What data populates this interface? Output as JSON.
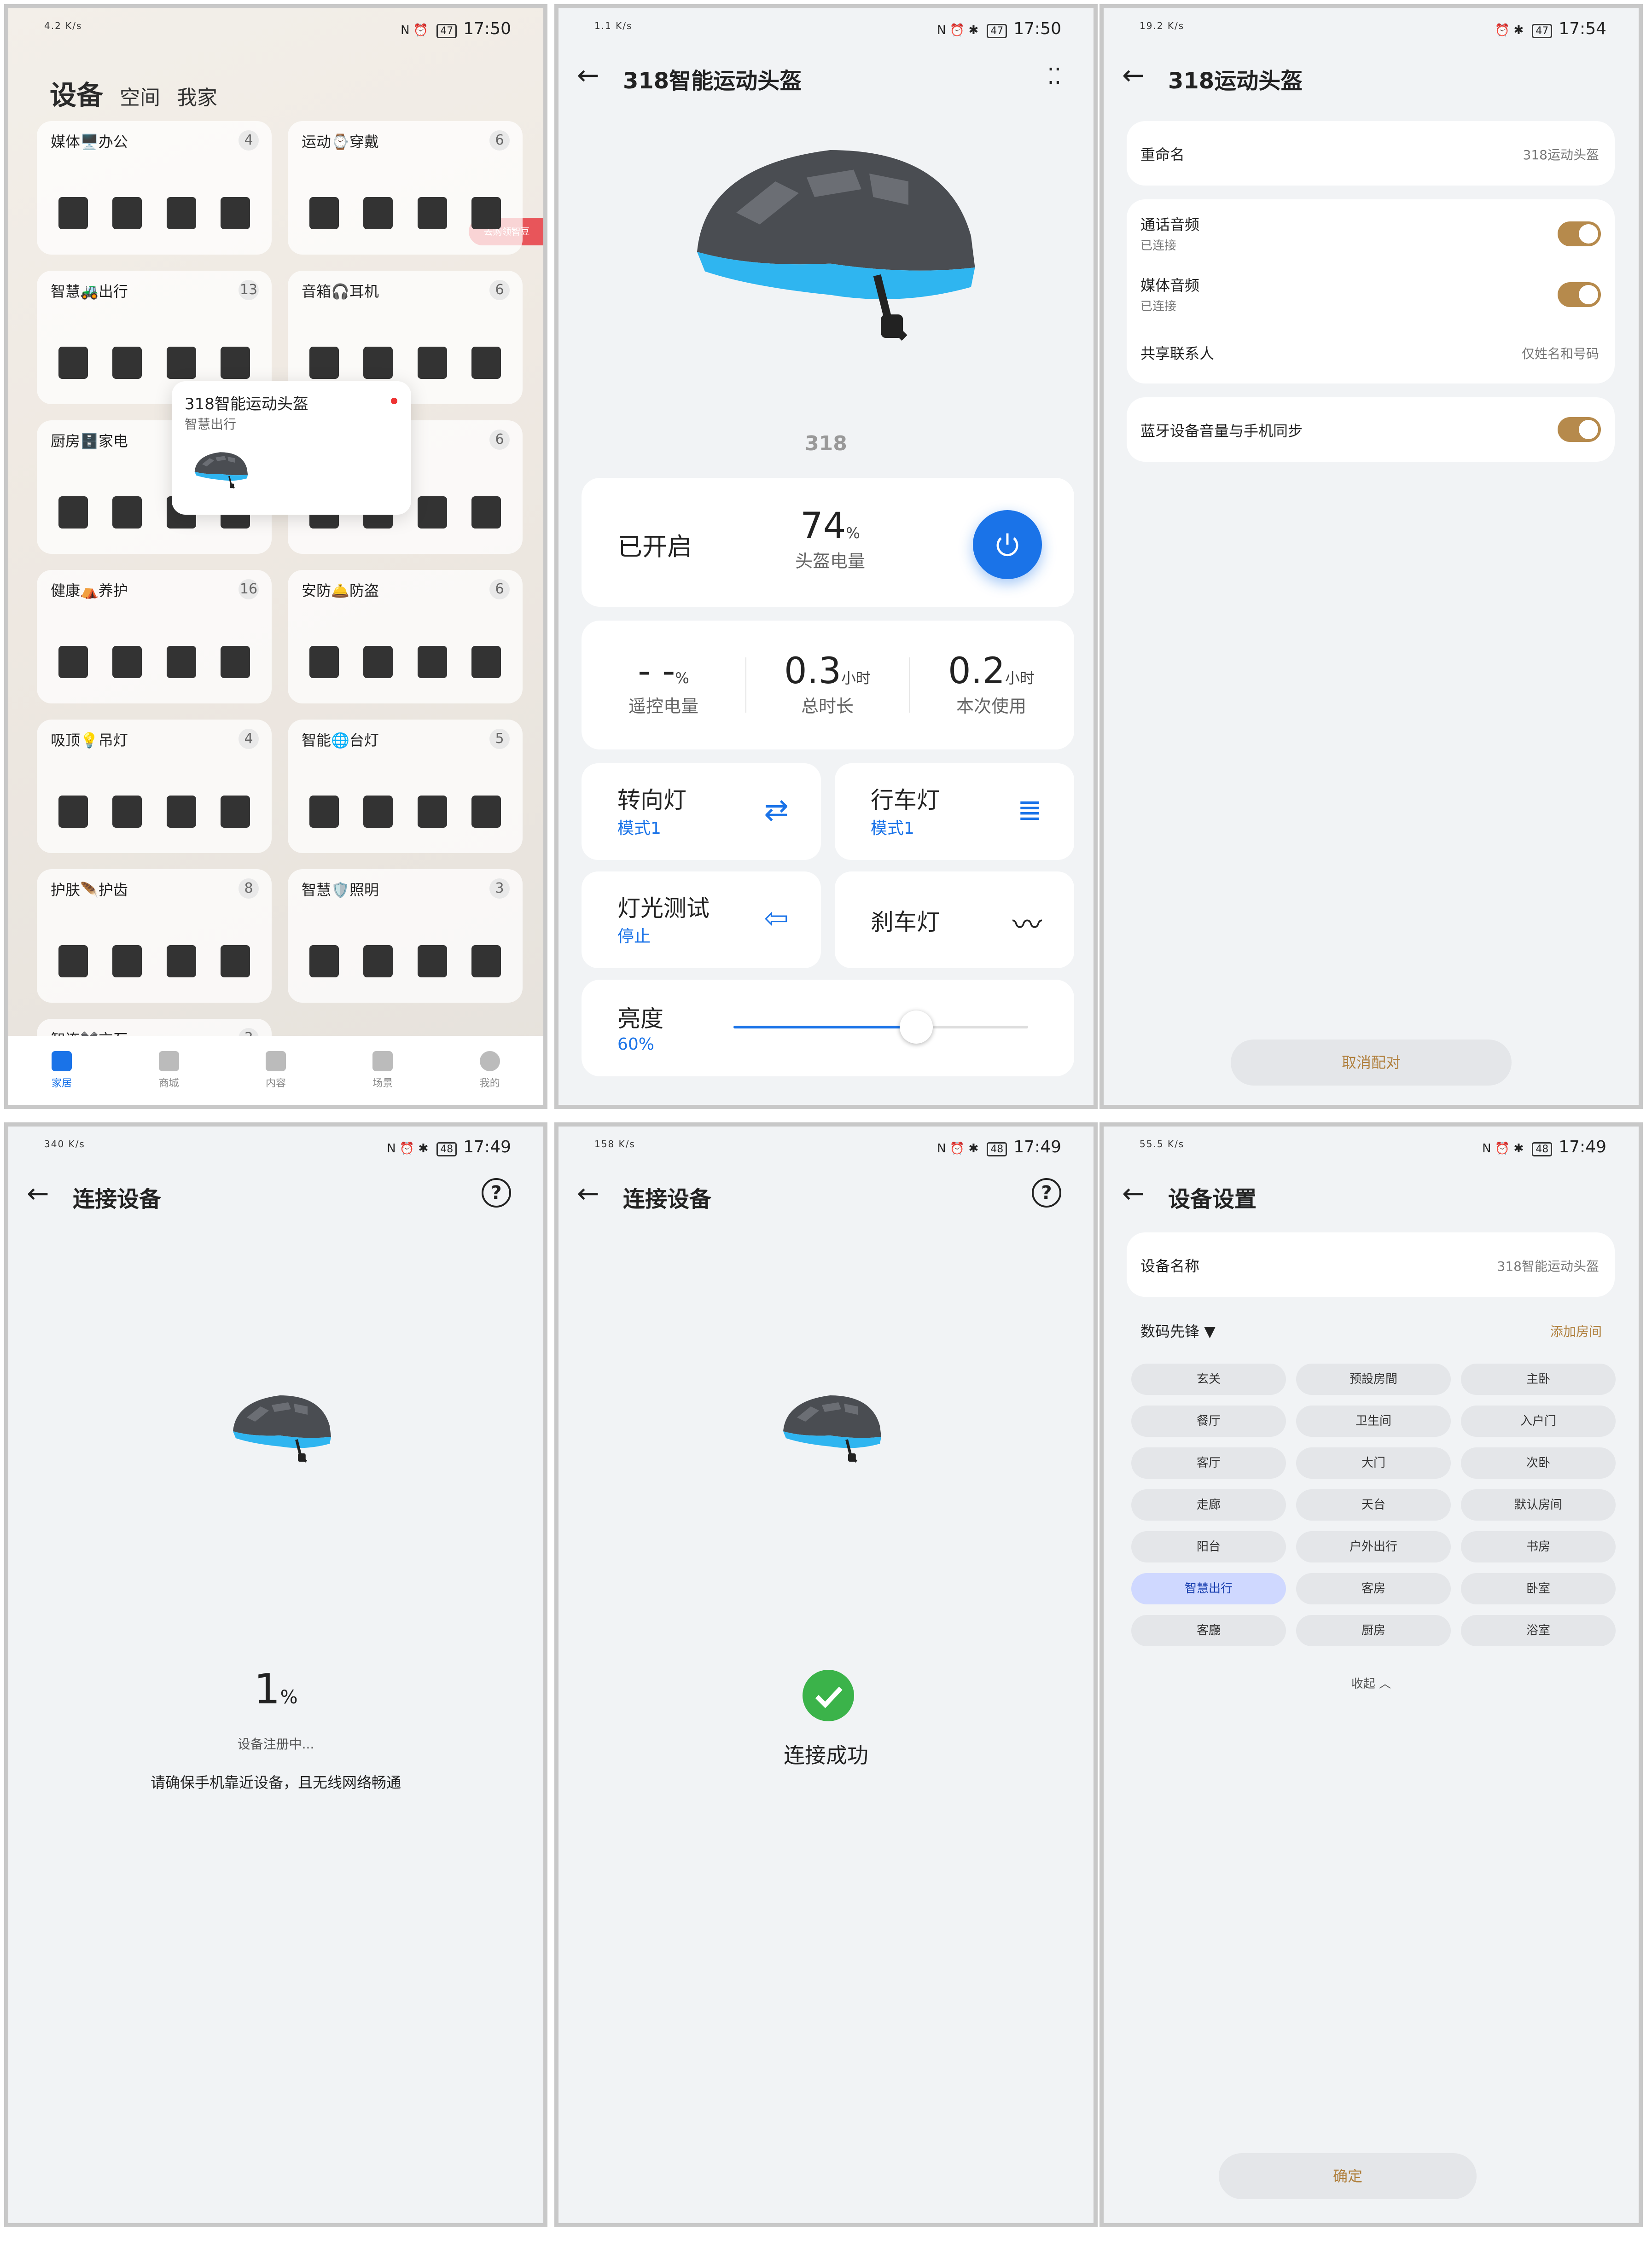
{
  "status": {
    "p1": {
      "speed": "4.2\nK/s",
      "time": "17:50",
      "battery": "47"
    },
    "p2": {
      "speed": "1.1\nK/s",
      "time": "17:50",
      "battery": "47"
    },
    "p3": {
      "speed": "19.2\nK/s",
      "time": "17:54",
      "battery": "47"
    },
    "p4": {
      "speed": "340\nK/s",
      "time": "17:49",
      "battery": "48"
    },
    "p5": {
      "speed": "158\nK/s",
      "time": "17:49",
      "battery": "48"
    },
    "p6": {
      "speed": "55.5\nK/s",
      "time": "17:49",
      "battery": "48"
    }
  },
  "home": {
    "tabs": [
      "设备",
      "空间",
      "我家"
    ],
    "groups": [
      {
        "name": "媒体🖥️办公",
        "count": "4"
      },
      {
        "name": "运动⌚穿戴",
        "count": "6"
      },
      {
        "name": "智慧🚜出行",
        "count": "13"
      },
      {
        "name": "音箱🎧耳机",
        "count": "6"
      },
      {
        "name": "厨房🗄️家电",
        "count": ""
      },
      {
        "name": "",
        "count": "6"
      },
      {
        "name": "健康⛺养护",
        "count": "16"
      },
      {
        "name": "安防🛎️防盗",
        "count": "6"
      },
      {
        "name": "吸顶💡吊灯",
        "count": "4"
      },
      {
        "name": "智能🌐台灯",
        "count": "5"
      },
      {
        "name": "护肤🪶护齿",
        "count": "8"
      },
      {
        "name": "智慧🛡️照明",
        "count": "3"
      },
      {
        "name": "智连✖️交互",
        "count": "3"
      }
    ],
    "badge": "去购领智豆",
    "popup": {
      "title": "318智能运动头盔",
      "subtitle": "智慧出行"
    },
    "nav": [
      "家居",
      "商城",
      "内容",
      "场景",
      "我的"
    ]
  },
  "helmet": {
    "title": "318智能运动头盔",
    "logo": "318",
    "state": "已开启",
    "battery_value": "74",
    "battery_unit": "%",
    "battery_label": "头盔电量",
    "stats": [
      {
        "value": "- -",
        "unit": "%",
        "label": "遥控电量"
      },
      {
        "value": "0.3",
        "unit": "小时",
        "label": "总时长"
      },
      {
        "value": "0.2",
        "unit": "小时",
        "label": "本次使用"
      }
    ],
    "tiles": [
      {
        "title": "转向灯",
        "sub": "模式1"
      },
      {
        "title": "行车灯",
        "sub": "模式1"
      },
      {
        "title": "灯光测试",
        "sub": "停止"
      },
      {
        "title": "刹车灯",
        "sub": ""
      }
    ],
    "brightness_label": "亮度",
    "brightness_value": "60%",
    "brightness_level": 0.6
  },
  "bt": {
    "title": "318运动头盔",
    "rename_label": "重命名",
    "rename_value": "318运动头盔",
    "call_label": "通话音频",
    "call_state": "已连接",
    "media_label": "媒体音频",
    "media_state": "已连接",
    "contacts_label": "共享联系人",
    "contacts_value": "仅姓名和号码",
    "sync_label": "蓝牙设备音量与手机同步",
    "unpair": "取消配对"
  },
  "connect": {
    "title": "连接设备",
    "progress": "1",
    "progress_unit": "%",
    "progress_text": "设备注册中...",
    "hint": "请确保手机靠近设备，且无线网络畅通",
    "success": "连接成功"
  },
  "settings": {
    "title": "设备设置",
    "name_label": "设备名称",
    "name_value": "318智能运动头盔",
    "group": "数码先锋",
    "add_room": "添加房间",
    "rooms": [
      "玄关",
      "预設房間",
      "主卧",
      "餐厅",
      "卫生间",
      "入户门",
      "客厅",
      "大门",
      "次卧",
      "走廊",
      "天台",
      "默认房间",
      "阳台",
      "户外出行",
      "书房",
      "智慧出行",
      "客房",
      "卧室",
      "客廳",
      "厨房",
      "浴室"
    ],
    "selected": "智慧出行",
    "collapse": "收起",
    "confirm": "确定"
  }
}
